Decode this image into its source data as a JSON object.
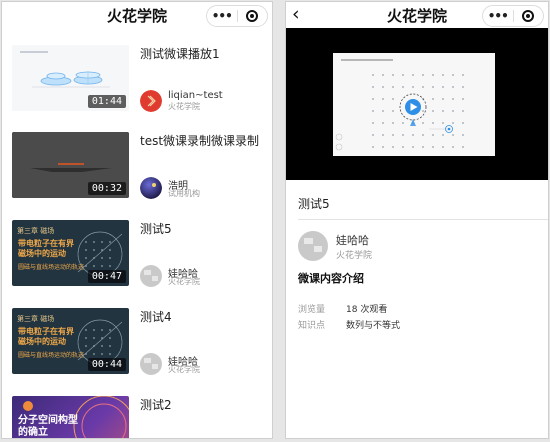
{
  "app": {
    "title": "火花学院"
  },
  "list": [
    {
      "title": "测试微课播放1",
      "duration": "01:44",
      "author": "liqian~test",
      "org": "火花学院"
    },
    {
      "title": "test微课录制微课录制",
      "duration": "00:32",
      "author": "浩明",
      "org": "试用机构"
    },
    {
      "title": "测试5",
      "duration": "00:47",
      "author": "娃哈哈",
      "org": "火花学院",
      "thumb": {
        "tag": "第三章 磁场",
        "headline": "带电粒子在有界磁场中的运动",
        "sub": "圆磁与直线场运动的轨迹"
      }
    },
    {
      "title": "测试4",
      "duration": "00:44",
      "author": "娃哈哈",
      "org": "火花学院",
      "thumb": {
        "tag": "第三章 磁场",
        "headline": "带电粒子在有界磁场中的运动",
        "sub": "圆磁与直线场运动的轨迹"
      }
    },
    {
      "title": "测试2",
      "thumb": {
        "headline": "分子空间构型的确立"
      }
    }
  ],
  "detail": {
    "lesson_title": "测试5",
    "author": "娃哈哈",
    "org": "火花学院",
    "section_title": "微课内容介绍",
    "views_label": "浏览量",
    "views_value": "18 次观看",
    "topic_label": "知识点",
    "topic_value": "数列与不等式"
  },
  "colors": {
    "accent_blue": "#2f8fe6",
    "avatar_red": "#e03b2f",
    "thumb_orange": "#f1a94a"
  }
}
